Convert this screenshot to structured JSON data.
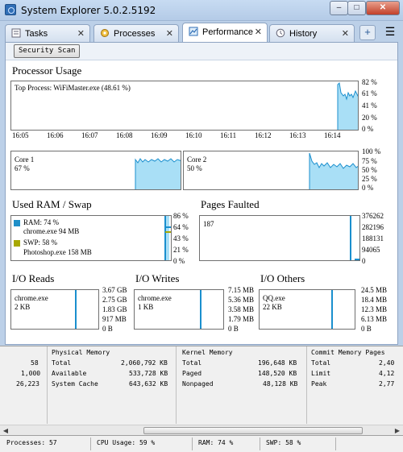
{
  "window": {
    "title": "System Explorer 5.0.2.5192"
  },
  "tabs": [
    {
      "label": "Tasks",
      "icon": "tasks-icon",
      "active": false
    },
    {
      "label": "Processes",
      "icon": "processes-icon",
      "active": false
    },
    {
      "label": "Performance",
      "icon": "performance-icon",
      "active": true
    },
    {
      "label": "History",
      "icon": "history-icon",
      "active": false
    }
  ],
  "toolbar": {
    "scan_label": "Security Scan"
  },
  "processor": {
    "title": "Processor Usage",
    "top_process": "Top Process: WiFiMaster.exe (48.61 %)",
    "y_ticks": [
      "82 %",
      "61 %",
      "41 %",
      "20 %",
      "0 %"
    ],
    "x_ticks": [
      "16:05",
      "16:06",
      "16:07",
      "16:08",
      "16:09",
      "16:10",
      "16:11",
      "16:12",
      "16:13",
      "16:14"
    ],
    "core1": "Core 1\n67 %",
    "core2": "Core 2\n50 %",
    "core_ticks": [
      "100 %",
      "75 %",
      "50 %",
      "25 %",
      "0 %"
    ],
    "core1_label": "Core 1",
    "core1_value": "67 %",
    "core2_label": "Core 2",
    "core2_value": "50 %"
  },
  "ram": {
    "title": "Used RAM / Swap",
    "ram_label": "RAM: 74 %",
    "ram_proc": "chrome.exe 94 MB",
    "swp_label": "SWP: 58 %",
    "swp_proc": "Photoshop.exe 158 MB",
    "y_ticks": [
      "86 %",
      "64 %",
      "43 %",
      "21 %",
      "0 %"
    ],
    "ram_color": "#1f8fc8",
    "swp_color": "#a8a800"
  },
  "faults": {
    "title": "Pages Faulted",
    "value": "187",
    "y_ticks": [
      "376262",
      "282196",
      "188131",
      "94065",
      "0"
    ]
  },
  "io_reads": {
    "title": "I/O Reads",
    "proc": "chrome.exe",
    "value": "2 KB",
    "y_ticks": [
      "3.67 GB",
      "2.75 GB",
      "1.83 GB",
      "917 MB",
      "0 B"
    ]
  },
  "io_writes": {
    "title": "I/O Writes",
    "proc": "chrome.exe",
    "value": "1 KB",
    "y_ticks": [
      "7.15 MB",
      "5.36 MB",
      "3.58 MB",
      "1.79 MB",
      "0 B"
    ]
  },
  "io_others": {
    "title": "I/O Others",
    "proc": "QQ.exe",
    "value": "22 KB",
    "y_ticks": [
      "24.5 MB",
      "18.4 MB",
      "12.3 MB",
      "6.13 MB",
      "0 B"
    ]
  },
  "stats": {
    "left_values": [
      "58",
      "1,000",
      "26,223"
    ],
    "physical": {
      "header": "Physical Memory",
      "rows": [
        {
          "label": "Total",
          "value": "2,060,792 KB"
        },
        {
          "label": "Available",
          "value": "533,728 KB"
        },
        {
          "label": "System Cache",
          "value": "643,632 KB"
        }
      ]
    },
    "kernel": {
      "header": "Kernel Memory",
      "rows": [
        {
          "label": "Total",
          "value": "196,648 KB"
        },
        {
          "label": "Paged",
          "value": "148,520 KB"
        },
        {
          "label": "Nonpaged",
          "value": "48,128 KB"
        }
      ]
    },
    "commit": {
      "header": "Commit Memory Pages",
      "rows": [
        {
          "label": "Total",
          "value": "2,40"
        },
        {
          "label": "Limit",
          "value": "4,12"
        },
        {
          "label": "Peak",
          "value": "2,77"
        }
      ]
    }
  },
  "status": {
    "processes": "Processes: 57",
    "cpu": "CPU Usage: 59 %",
    "ram": "RAM: 74 %",
    "swp": "SWP: 58 %"
  },
  "colors": {
    "graph_fill": "#a9dff6",
    "graph_line": "#1a8fce"
  }
}
